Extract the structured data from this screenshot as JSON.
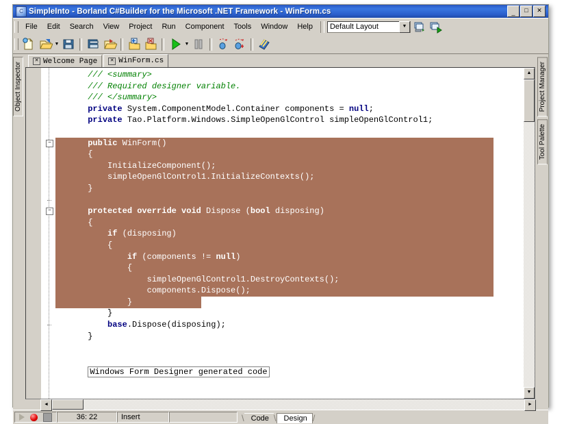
{
  "window": {
    "title": "SimpleInto - Borland C#Builder for the Microsoft .NET Framework - WinForm.cs",
    "app_icon": "app-icon",
    "minimize": "_",
    "maximize": "□",
    "close": "✕"
  },
  "menu": {
    "items": [
      "File",
      "Edit",
      "Search",
      "View",
      "Project",
      "Run",
      "Component",
      "Tools",
      "Window",
      "Help"
    ],
    "layout_combo": {
      "value": "Default Layout",
      "arrow": "▼"
    },
    "layout_buttons": [
      "save-layout-icon",
      "apply-layout-icon"
    ]
  },
  "toolbar": {
    "buttons": [
      {
        "name": "new-icon"
      },
      {
        "name": "open-icon",
        "has_dropdown": true
      },
      {
        "name": "save-icon"
      },
      {
        "name": "save-all-icon"
      },
      {
        "name": "open-project-icon"
      },
      {
        "name": "add-to-project-icon"
      },
      {
        "name": "remove-from-project-icon"
      },
      {
        "name": "run-icon",
        "has_dropdown": true
      },
      {
        "name": "pause-icon"
      },
      {
        "name": "trace-into-icon"
      },
      {
        "name": "step-over-icon"
      },
      {
        "name": "help-icon"
      }
    ],
    "dropdown_arrow": "▼"
  },
  "panels": {
    "left": [
      "Object Inspector"
    ],
    "right": [
      "Project Manager",
      "Tool Palette"
    ]
  },
  "editor": {
    "tabs": [
      {
        "label": "Welcome Page",
        "close": "✕",
        "active": false
      },
      {
        "label": "WinForm.cs",
        "close": "✕",
        "active": true
      }
    ],
    "region_box": "Windows Form Designer generated code",
    "fold_markers": [
      "−",
      "−"
    ],
    "scroll": {
      "up": "▲",
      "down": "▼",
      "left": "◄",
      "right": "►"
    },
    "lines": [
      {
        "indent": 3,
        "selected": false,
        "tokens": [
          {
            "t": "/// <summary>",
            "c": "cm"
          }
        ]
      },
      {
        "indent": 3,
        "selected": false,
        "tokens": [
          {
            "t": "/// Required designer variable.",
            "c": "cm"
          }
        ]
      },
      {
        "indent": 3,
        "selected": false,
        "tokens": [
          {
            "t": "/// </summary>",
            "c": "cm"
          }
        ]
      },
      {
        "indent": 3,
        "selected": false,
        "tokens": [
          {
            "t": "private",
            "c": "kw"
          },
          {
            "t": " System.ComponentModel.Container components = ",
            "c": "pl"
          },
          {
            "t": "null",
            "c": "kw"
          },
          {
            "t": ";",
            "c": "pl"
          }
        ]
      },
      {
        "indent": 3,
        "selected": false,
        "tokens": [
          {
            "t": "private",
            "c": "kw"
          },
          {
            "t": " Tao.Platform.Windows.SimpleOpenGlControl simpleOpenGlControl1;",
            "c": "pl"
          }
        ]
      },
      {
        "indent": 0,
        "selected": false,
        "tokens": []
      },
      {
        "indent": 3,
        "selected": true,
        "tokens": [
          {
            "t": "public",
            "c": "kw"
          },
          {
            "t": " WinForm()",
            "c": "pl"
          }
        ]
      },
      {
        "indent": 3,
        "selected": true,
        "tokens": [
          {
            "t": "{",
            "c": "pl"
          }
        ]
      },
      {
        "indent": 5,
        "selected": true,
        "tokens": [
          {
            "t": "InitializeComponent();",
            "c": "pl"
          }
        ]
      },
      {
        "indent": 5,
        "selected": true,
        "tokens": [
          {
            "t": "simpleOpenGlControl1.InitializeContexts();",
            "c": "pl"
          }
        ]
      },
      {
        "indent": 3,
        "selected": true,
        "tokens": [
          {
            "t": "}",
            "c": "pl"
          }
        ]
      },
      {
        "indent": 0,
        "selected": true,
        "tokens": []
      },
      {
        "indent": 3,
        "selected": true,
        "tokens": [
          {
            "t": "protected override void",
            "c": "kw"
          },
          {
            "t": " Dispose (",
            "c": "pl"
          },
          {
            "t": "bool",
            "c": "kw"
          },
          {
            "t": " disposing)",
            "c": "pl"
          }
        ]
      },
      {
        "indent": 3,
        "selected": true,
        "tokens": [
          {
            "t": "{",
            "c": "pl"
          }
        ]
      },
      {
        "indent": 5,
        "selected": true,
        "tokens": [
          {
            "t": "if",
            "c": "kw"
          },
          {
            "t": " (disposing)",
            "c": "pl"
          }
        ]
      },
      {
        "indent": 5,
        "selected": true,
        "tokens": [
          {
            "t": "{",
            "c": "pl"
          }
        ]
      },
      {
        "indent": 7,
        "selected": true,
        "tokens": [
          {
            "t": "if",
            "c": "kw"
          },
          {
            "t": " (components != ",
            "c": "pl"
          },
          {
            "t": "null",
            "c": "kw"
          },
          {
            "t": ")",
            "c": "pl"
          }
        ]
      },
      {
        "indent": 7,
        "selected": true,
        "tokens": [
          {
            "t": "{",
            "c": "pl"
          }
        ]
      },
      {
        "indent": 9,
        "selected": true,
        "tokens": [
          {
            "t": "simpleOpenGlControl1.DestroyContexts();",
            "c": "pl"
          }
        ]
      },
      {
        "indent": 9,
        "selected": true,
        "tokens": [
          {
            "t": "components.Dispose();",
            "c": "pl"
          }
        ]
      },
      {
        "indent": 7,
        "selected": true,
        "tokens": [
          {
            "t": "}",
            "c": "pl"
          }
        ]
      },
      {
        "indent": 5,
        "selected": false,
        "tokens": [
          {
            "t": "}",
            "c": "pl"
          }
        ]
      },
      {
        "indent": 5,
        "selected": false,
        "tokens": [
          {
            "t": "base",
            "c": "kw"
          },
          {
            "t": ".Dispose(disposing);",
            "c": "pl"
          }
        ]
      },
      {
        "indent": 3,
        "selected": false,
        "tokens": [
          {
            "t": "}",
            "c": "pl"
          }
        ]
      },
      {
        "indent": 0,
        "selected": false,
        "tokens": []
      },
      {
        "indent": 0,
        "selected": false,
        "tokens": []
      }
    ]
  },
  "statusbar": {
    "caret_position": "36: 22",
    "insert_mode": "Insert",
    "extra": "",
    "view_tabs": [
      {
        "label": "Code",
        "selected": false
      },
      {
        "label": "Design",
        "selected": true
      }
    ],
    "buttons": [
      "play-icon",
      "record-icon",
      "stop-icon"
    ]
  },
  "colors": {
    "selection_bg": "#a8725a",
    "title_bar": "#2f64d0",
    "chrome": "#d4d0c8",
    "comment": "#008000",
    "keyword": "#000080"
  }
}
